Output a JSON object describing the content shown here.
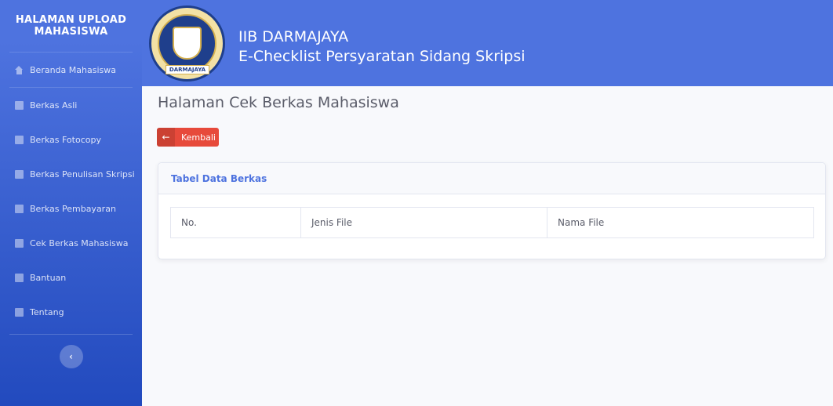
{
  "sidebar": {
    "brand": "HALAMAN UPLOAD MAHASISWA",
    "items": [
      {
        "label": "Beranda Mahasiswa",
        "icon": "home-icon"
      },
      {
        "label": "Berkas Asli",
        "icon": "file-icon"
      },
      {
        "label": "Berkas Fotocopy",
        "icon": "file-icon"
      },
      {
        "label": "Berkas Penulisan Skripsi",
        "icon": "file-icon"
      },
      {
        "label": "Berkas Pembayaran",
        "icon": "file-icon"
      },
      {
        "label": "Cek Berkas Mahasiswa",
        "icon": "file-icon"
      },
      {
        "label": "Bantuan",
        "icon": "file-icon"
      },
      {
        "label": "Tentang",
        "icon": "file-icon"
      }
    ],
    "toggle_icon": "‹"
  },
  "header": {
    "logo_text": "DARMAJAYA",
    "title": "IIB DARMAJAYA",
    "subtitle": "E-Checklist Persyaratan Sidang Skripsi"
  },
  "main": {
    "page_title": "Halaman Cek Berkas Mahasiswa",
    "back_button": {
      "icon": "←",
      "label": "Kembali"
    },
    "card": {
      "title": "Tabel Data Berkas",
      "columns": [
        "No.",
        "Jenis File",
        "Nama File"
      ],
      "rows": []
    }
  },
  "colors": {
    "primary": "#4e73df",
    "danger": "#e74a3b",
    "text": "#5a5c69"
  }
}
